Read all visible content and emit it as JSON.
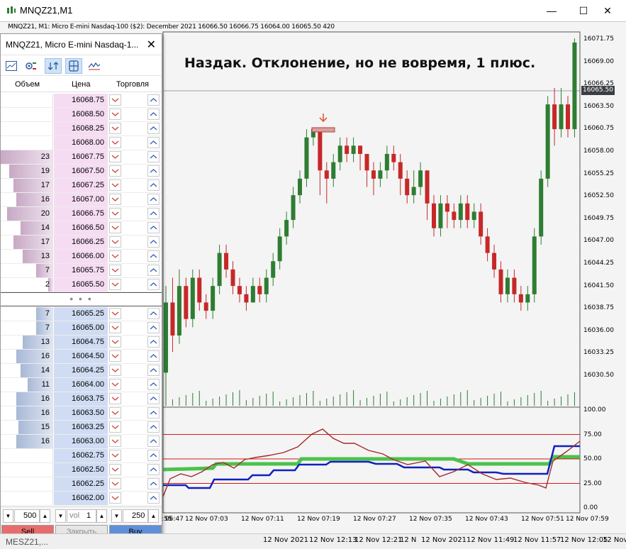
{
  "window": {
    "title": "MNQZ21,M1",
    "minimize": "—",
    "maximize": "☐",
    "close": "✕"
  },
  "chart": {
    "header": "MNQZ21, M1:  Micro E-mini Nasdaq-100 ($2): December 2021   16066.50  16066.75  16064.00  16065.50  420",
    "annotation": "Наздак. Отклонение, но не вовремя, 1 плюс.",
    "current_price": "16065.50",
    "price_labels": [
      "16071.75",
      "16069.00",
      "16066.25",
      "16063.50",
      "16060.75",
      "16058.00",
      "16055.25",
      "16052.50",
      "16049.75",
      "16047.00",
      "16044.25",
      "16041.50",
      "16038.75",
      "16036.00",
      "16033.25",
      "16030.50"
    ],
    "oscillator_labels": [
      "100.00",
      "75.00",
      "50.00",
      "25.00",
      "0.00"
    ],
    "time_labels": [
      "06:47",
      "12 Nov 06:55",
      "12 Nov 07:03",
      "12 Nov 07:11",
      "12 Nov 07:19",
      "12 Nov 07:27",
      "12 Nov 07:35",
      "12 Nov 07:43",
      "12 Nov 07:51",
      "12 Nov 07:59"
    ],
    "bottom_times": [
      "12 Nov 2021",
      "12 Nov 12:13",
      "12 Nov 12:21",
      "12 N",
      "12 Nov 2021",
      "12 Nov 11:49",
      "12 Nov 11:57",
      "12 Nov 12:05",
      "12 Nov"
    ],
    "bottom_tab": "MESZ21,...",
    "colors": {
      "bull": "#2e7d32",
      "bear": "#c62828",
      "osc_brown": "#a52a2a",
      "osc_blue": "#1020c0",
      "osc_green": "#4cc24c",
      "level_red": "#d11a1a"
    }
  },
  "dom": {
    "title": "MNQZ21, Micro E-mini Nasdaq-1...",
    "close": "✕",
    "headers": {
      "volume": "Объем",
      "price": "Цена",
      "trade": "Торговля"
    },
    "asks": [
      {
        "price": "16068.75",
        "volume": ""
      },
      {
        "price": "16068.50",
        "volume": ""
      },
      {
        "price": "16068.25",
        "volume": ""
      },
      {
        "price": "16068.00",
        "volume": ""
      },
      {
        "price": "16067.75",
        "volume": "23"
      },
      {
        "price": "16067.50",
        "volume": "19"
      },
      {
        "price": "16067.25",
        "volume": "17"
      },
      {
        "price": "16067.00",
        "volume": "16"
      },
      {
        "price": "16066.75",
        "volume": "20"
      },
      {
        "price": "16066.50",
        "volume": "14"
      },
      {
        "price": "16066.25",
        "volume": "17"
      },
      {
        "price": "16066.00",
        "volume": "13"
      },
      {
        "price": "16065.75",
        "volume": "7"
      },
      {
        "price": "16065.50",
        "volume": "2"
      }
    ],
    "separator": "• • •",
    "bids": [
      {
        "price": "16065.25",
        "volume": "7"
      },
      {
        "price": "16065.00",
        "volume": "7"
      },
      {
        "price": "16064.75",
        "volume": "13"
      },
      {
        "price": "16064.50",
        "volume": "16"
      },
      {
        "price": "16064.25",
        "volume": "14"
      },
      {
        "price": "16064.00",
        "volume": "11"
      },
      {
        "price": "16063.75",
        "volume": "16"
      },
      {
        "price": "16063.50",
        "volume": "16"
      },
      {
        "price": "16063.25",
        "volume": "15"
      },
      {
        "price": "16063.00",
        "volume": "16"
      },
      {
        "price": "16062.75",
        "volume": ""
      },
      {
        "price": "16062.50",
        "volume": ""
      },
      {
        "price": "16062.25",
        "volume": ""
      },
      {
        "price": "16062.00",
        "volume": ""
      }
    ],
    "footer": {
      "left_qty": "500",
      "vol_label": "vol",
      "vol_value": "1",
      "right_qty": "250",
      "sell": "Sell",
      "close_position": "Закрыть",
      "buy": "Buy"
    }
  }
}
